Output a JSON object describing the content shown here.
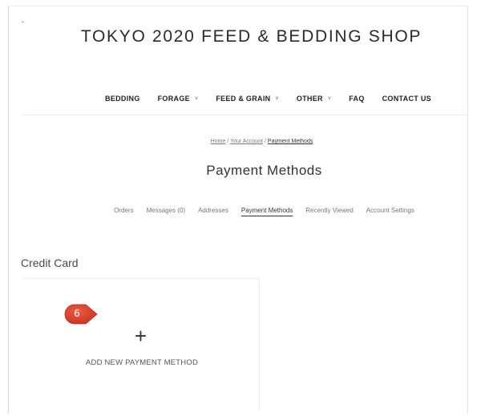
{
  "colors": {
    "background": "#ffffff",
    "text": "#2f2f2f",
    "muted": "#777777",
    "callout": "#d8432f"
  },
  "shop": {
    "title": "TOKYO 2020 FEED & BEDDING SHOP"
  },
  "nav": {
    "items": [
      {
        "label": "BEDDING",
        "has_caret": false
      },
      {
        "label": "FORAGE",
        "has_caret": true
      },
      {
        "label": "FEED & GRAIN",
        "has_caret": true
      },
      {
        "label": "OTHER",
        "has_caret": true
      },
      {
        "label": "FAQ",
        "has_caret": false
      },
      {
        "label": "CONTACT US",
        "has_caret": false
      }
    ],
    "caret_glyph": "˅"
  },
  "breadcrumb": {
    "items": [
      "Home",
      "Your Account",
      "Payment Methods"
    ],
    "separator": "/"
  },
  "page": {
    "title": "Payment Methods"
  },
  "account_tabs": {
    "items": [
      "Orders",
      "Messages (0)",
      "Addresses",
      "Payment Methods",
      "Recently Viewed",
      "Account Settings"
    ],
    "active": "Payment Methods"
  },
  "credit_card": {
    "section_title": "Credit Card",
    "add_card": {
      "icon": "plus-icon",
      "plus_glyph": "+",
      "label": "ADD NEW PAYMENT METHOD"
    }
  },
  "callout": {
    "number": "6"
  },
  "corner_mark": "-"
}
